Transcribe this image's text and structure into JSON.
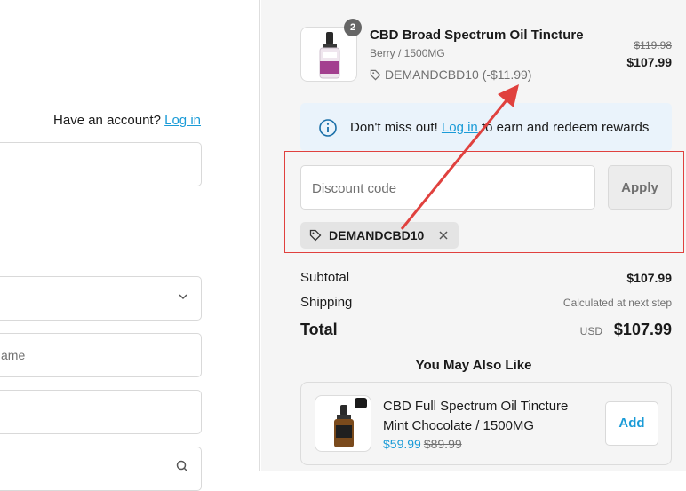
{
  "left": {
    "account_prompt": "Have an account?",
    "login_link": "Log in",
    "fields": [
      {
        "placeholder": ""
      },
      {
        "placeholder": ""
      },
      {
        "placeholder": "ame"
      },
      {
        "placeholder": ""
      },
      {
        "placeholder": ""
      }
    ]
  },
  "order": {
    "product": {
      "quantity": "2",
      "title": "CBD Broad Spectrum Oil Tincture",
      "variant": "Berry / 1500MG",
      "discount_line": "DEMANDCBD10 (-$11.99)",
      "original_price": "$119.98",
      "price": "$107.99"
    },
    "banner": {
      "prefix": "Don't miss out!",
      "link": "Log in",
      "suffix": "to earn and redeem rewards"
    },
    "discount": {
      "placeholder": "Discount code",
      "apply_label": "Apply",
      "applied_code": "DEMANDCBD10"
    },
    "totals": {
      "subtotal_label": "Subtotal",
      "subtotal_value": "$107.99",
      "shipping_label": "Shipping",
      "shipping_value": "Calculated at next step",
      "total_label": "Total",
      "currency": "USD",
      "total_value": "$107.99"
    },
    "recommendations": {
      "heading": "You May Also Like",
      "items": [
        {
          "title": "CBD Full Spectrum Oil Tincture",
          "variant": "Mint Chocolate / 1500MG",
          "sale_price": "$59.99",
          "original_price": "$89.99",
          "add_label": "Add"
        }
      ]
    }
  },
  "colors": {
    "accent_link": "#1a9bd7",
    "annotation_red": "#e0413e",
    "summary_background": "#f5f5f5",
    "banner_background": "#eaf3fb"
  },
  "icons": [
    "info-icon",
    "tag-icon",
    "close-icon",
    "chevron-down-icon",
    "search-icon"
  ]
}
